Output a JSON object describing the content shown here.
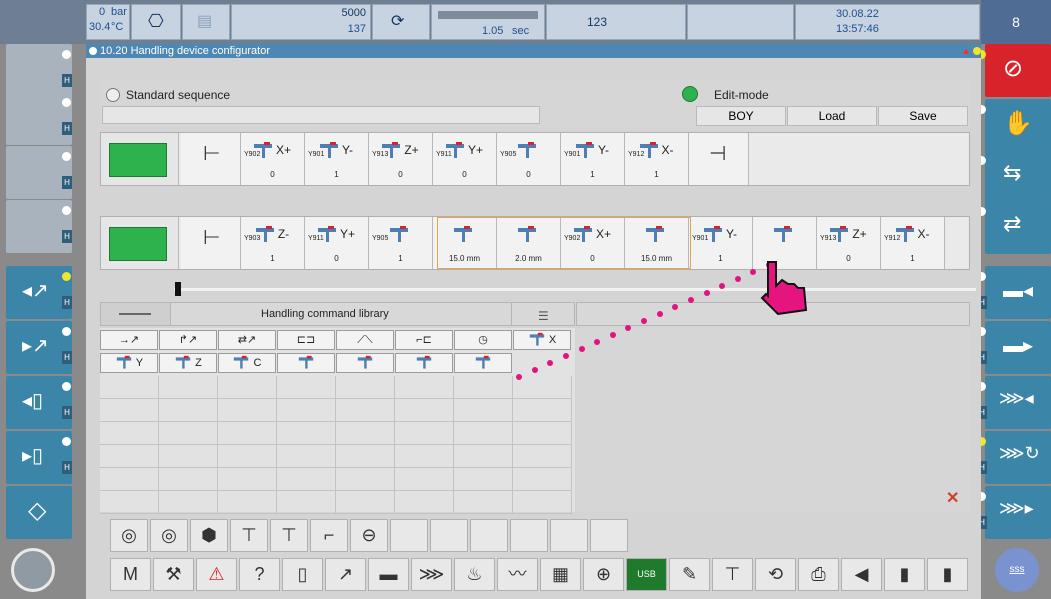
{
  "topbar": {
    "pressure_value": "0",
    "pressure_unit": "bar",
    "temp_value": "30.4",
    "temp_unit": "°C",
    "counter_top": "5000",
    "counter_bottom": "137",
    "cycle_time": "1.05",
    "cycle_unit": "sec",
    "part_count": "123",
    "date": "30.08.22",
    "time": "13:57:46",
    "screen_no": "8"
  },
  "window": {
    "title": "10.20 Handling device configurator"
  },
  "controls": {
    "standard_sequence_label": "Standard sequence",
    "edit_mode_label": "Edit-mode",
    "boy_button": "BOY",
    "load_button": "Load",
    "save_button": "Save"
  },
  "sequence1": [
    {
      "label": "X+",
      "sub": "Y902",
      "value": "0"
    },
    {
      "label": "Y-",
      "sub": "Y901",
      "value": "1"
    },
    {
      "label": "Z+",
      "sub": "Y913",
      "value": "0"
    },
    {
      "label": "Y+",
      "sub": "Y911",
      "value": "0"
    },
    {
      "label": "",
      "sub": "Y905",
      "value": "0"
    },
    {
      "label": "Y-",
      "sub": "Y901",
      "value": "1"
    },
    {
      "label": "X-",
      "sub": "Y912",
      "value": "1"
    }
  ],
  "sequence2": [
    {
      "label": "Z-",
      "sub": "Y903",
      "value": "1"
    },
    {
      "label": "Y+",
      "sub": "Y911",
      "value": "0"
    },
    {
      "label": "",
      "sub": "Y905",
      "value": "1"
    },
    {
      "label": "",
      "sub": "",
      "value": "15.0 mm"
    },
    {
      "label": "",
      "sub": "",
      "value": "2.0 mm"
    },
    {
      "label": "X+",
      "sub": "Y902",
      "value": "0"
    },
    {
      "label": "",
      "sub": "",
      "value": "15.0 mm"
    },
    {
      "label": "Y-",
      "sub": "Y901",
      "value": "1"
    },
    {
      "label": "",
      "sub": "",
      "value": ""
    },
    {
      "label": "Z+",
      "sub": "Y913",
      "value": "0"
    },
    {
      "label": "X-",
      "sub": "Y912",
      "value": "1"
    }
  ],
  "library": {
    "title": "Handling command library",
    "row2_labels": [
      "Y",
      "Z",
      "C"
    ],
    "row1_last": "X"
  },
  "icons": {
    "emergency": "stop-icon",
    "help": "?"
  },
  "bottom_toolbar": {
    "m_label": "M",
    "help_label": "?",
    "usb_label": "USB",
    "sss_label": "sss"
  }
}
